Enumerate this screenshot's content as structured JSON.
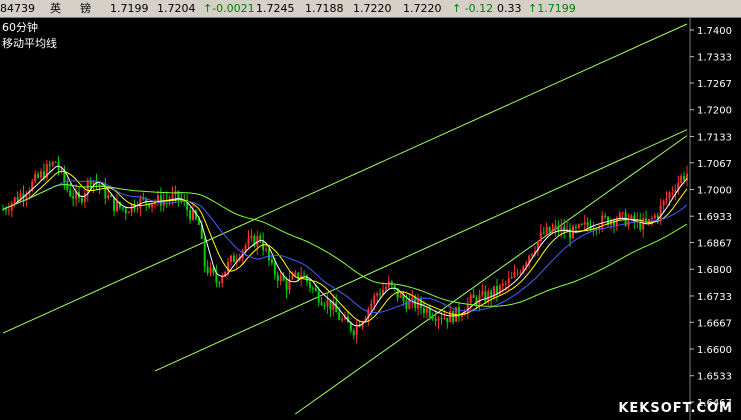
{
  "quote": {
    "code": "84739",
    "name_1": "英",
    "name_2": "镑",
    "open": "1.7199",
    "prev": "1.7204",
    "change": "↑-0.0021",
    "high": "1.7245",
    "low": "1.7188",
    "last": "1.7220",
    "close": "1.7220",
    "change_2": "↑ -0.12",
    "pct": "0.33",
    "price": "↑1.7199"
  },
  "period_label": "60分钟",
  "indicator_label": "移动平均线",
  "logo": "KEKSOFT.COM",
  "colors": {
    "bg": "#000000",
    "up": "#ff3030",
    "down": "#00d000",
    "ma_white": "#ffffff",
    "ma_yellow": "#ffff00",
    "ma_blue": "#4060ff",
    "ma_green": "#80ff40",
    "channel": "#a0ff60",
    "axis_text": "#ffffff"
  },
  "chart_data": {
    "type": "line",
    "ylim": [
      1.6437,
      1.7425
    ],
    "y_ticks": [
      "1.7400",
      "1.7333",
      "1.7267",
      "1.7200",
      "1.7133",
      "1.7067",
      "1.7000",
      "1.6933",
      "1.6867",
      "1.6800",
      "1.6733",
      "1.6667",
      "1.6600",
      "1.6533",
      "1.6467"
    ],
    "x_count": 235,
    "anchors": [
      [
        0,
        1.695
      ],
      [
        8,
        1.7
      ],
      [
        15,
        1.705
      ],
      [
        18,
        1.707
      ],
      [
        22,
        1.7
      ],
      [
        26,
        1.697
      ],
      [
        30,
        1.703
      ],
      [
        34,
        1.7
      ],
      [
        38,
        1.696
      ],
      [
        42,
        1.695
      ],
      [
        46,
        1.697
      ],
      [
        52,
        1.697
      ],
      [
        60,
        1.698
      ],
      [
        64,
        1.694
      ],
      [
        67,
        1.691
      ],
      [
        69,
        1.681
      ],
      [
        73,
        1.677
      ],
      [
        78,
        1.682
      ],
      [
        83,
        1.686
      ],
      [
        88,
        1.688
      ],
      [
        92,
        1.68
      ],
      [
        97,
        1.676
      ],
      [
        102,
        1.679
      ],
      [
        107,
        1.674
      ],
      [
        112,
        1.671
      ],
      [
        116,
        1.667
      ],
      [
        120,
        1.665
      ],
      [
        124,
        1.669
      ],
      [
        128,
        1.674
      ],
      [
        132,
        1.676
      ],
      [
        137,
        1.672
      ],
      [
        142,
        1.671
      ],
      [
        147,
        1.669
      ],
      [
        152,
        1.668
      ],
      [
        156,
        1.669
      ],
      [
        160,
        1.672
      ],
      [
        165,
        1.673
      ],
      [
        170,
        1.675
      ],
      [
        175,
        1.678
      ],
      [
        180,
        1.684
      ],
      [
        185,
        1.689
      ],
      [
        190,
        1.69
      ],
      [
        195,
        1.689
      ],
      [
        200,
        1.691
      ],
      [
        205,
        1.692
      ],
      [
        210,
        1.693
      ],
      [
        215,
        1.692
      ],
      [
        220,
        1.691
      ],
      [
        224,
        1.694
      ],
      [
        228,
        1.699
      ],
      [
        232,
        1.703
      ],
      [
        234,
        1.704
      ]
    ],
    "ma_periods": [
      5,
      10,
      20,
      60
    ]
  }
}
